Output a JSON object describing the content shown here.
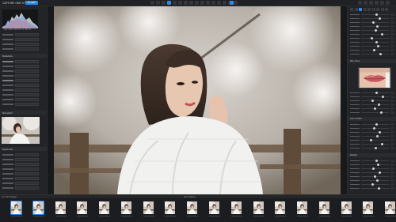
{
  "app": {
    "title": "CAPTURE ONE STYLES",
    "active_tab": "HI-DEF"
  },
  "left_panel": {
    "hist_info": "ISO 100  1/500  f/1.4  85mm",
    "section_metadata": "Metadata",
    "section_navigator": "Navigator",
    "section_keywords": "Keywords"
  },
  "right_panel": {
    "section_skin": "Skin Tone",
    "section_color": "Color Editor",
    "section_details": "Details"
  },
  "filmstrip": {
    "label_left": "8 / 20  Images",
    "label_mid": "Sort: Name",
    "thumb_count": 18
  },
  "colors": {
    "accent": "#2c8ae8",
    "panel": "#232427",
    "background": "#1b1b1d"
  }
}
